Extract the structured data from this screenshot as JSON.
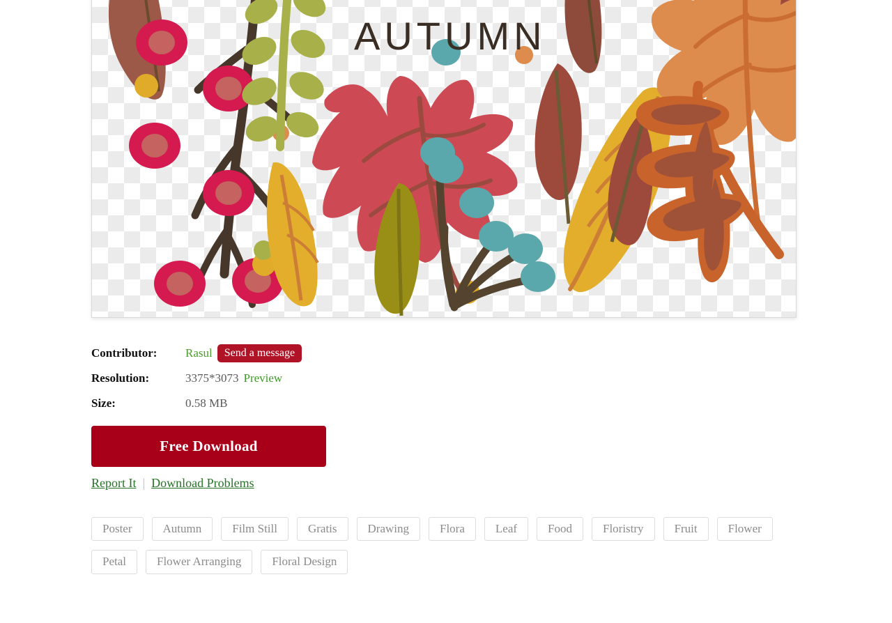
{
  "preview": {
    "alt_title": "AUTUMN",
    "overlay_text": "AUTUMN",
    "transparency_checkerboard": true,
    "checker_colors": [
      "#ffffff",
      "#ebebeb"
    ]
  },
  "meta": {
    "contributor_label": "Contributor:",
    "contributor_name": "Rasul",
    "send_message_label": "Send a message",
    "resolution_label": "Resolution:",
    "resolution_value": "3375*3073",
    "preview_link_label": "Preview",
    "size_label": "Size:",
    "size_value": "0.58 MB"
  },
  "download": {
    "button_label": "Free Download"
  },
  "links": {
    "report_label": "Report It",
    "separator": "|",
    "download_problems_label": "Download Problems"
  },
  "tags": [
    "Poster",
    "Autumn",
    "Film Still",
    "Gratis",
    "Drawing",
    "Flora",
    "Leaf",
    "Food",
    "Floristry",
    "Fruit",
    "Flower",
    "Petal",
    "Flower Arranging",
    "Floral Design"
  ],
  "colors": {
    "accent_red": "#a80019",
    "message_red": "#b01226",
    "link_green": "#267326",
    "contributor_green": "#4c9c2e",
    "tag_border": "#dcdcdc",
    "tag_text": "#8b8b8b",
    "autumn_text": "#3a2e24"
  }
}
